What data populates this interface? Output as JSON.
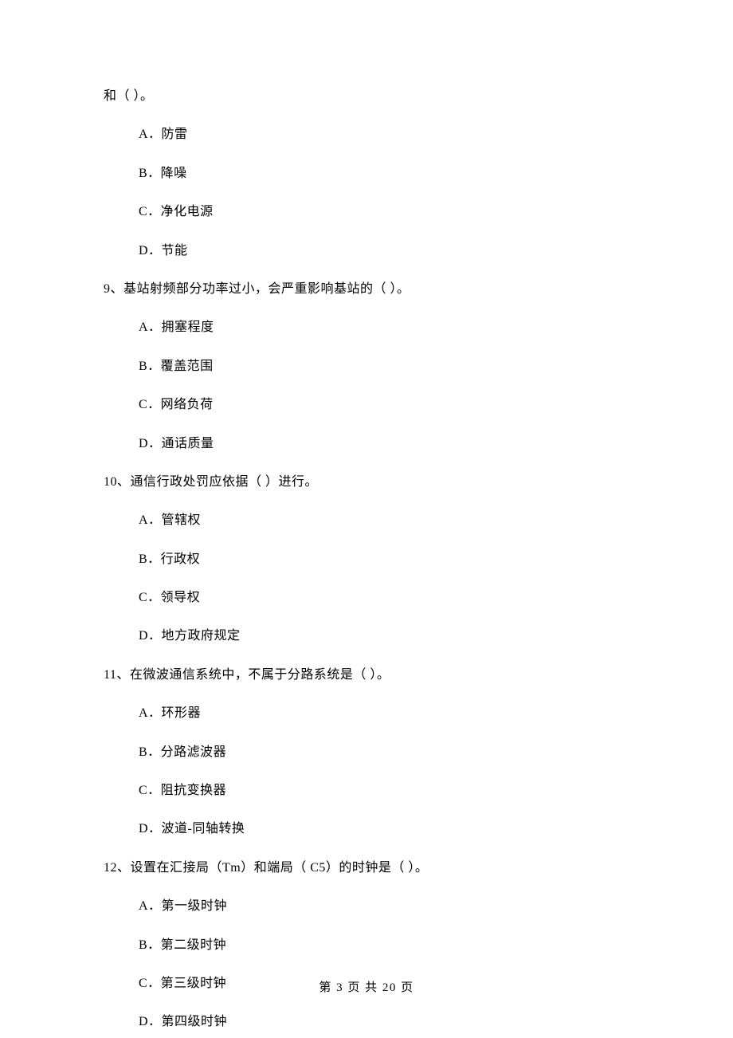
{
  "continuation": {
    "text": "和（    ）。",
    "options": [
      "A．防雷",
      "B．降噪",
      "C．净化电源",
      "D．节能"
    ]
  },
  "questions": [
    {
      "stem": "9、基站射频部分功率过小，会严重影响基站的（    ）。",
      "options": [
        "A．拥塞程度",
        "B．覆盖范围",
        "C．网络负荷",
        "D．通话质量"
      ]
    },
    {
      "stem": "10、通信行政处罚应依据（    ）进行。",
      "options": [
        "A．管辖权",
        "B．行政权",
        "C．领导权",
        "D．地方政府规定"
      ]
    },
    {
      "stem": "11、在微波通信系统中，不属于分路系统是（    ）。",
      "options": [
        "A．环形器",
        "B．分路滤波器",
        "C．阻抗变换器",
        "D．波道-同轴转换"
      ]
    },
    {
      "stem": "12、设置在汇接局（Tm）和端局（ C5）的时钟是（    ）。",
      "options": [
        "A．第一级时钟",
        "B．第二级时钟",
        "C．第三级时钟",
        "D．第四级时钟"
      ]
    }
  ],
  "footer": "第 3 页 共 20 页"
}
